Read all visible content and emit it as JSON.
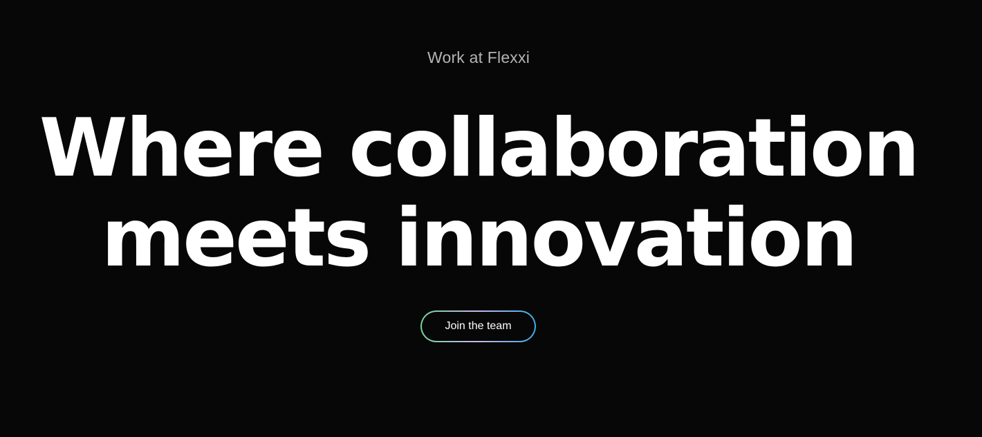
{
  "hero": {
    "eyebrow": "Work at Flexxi",
    "headline_line1": "Where collaboration",
    "headline_line2": "meets innovation",
    "cta_label": "Join the team"
  },
  "colors": {
    "background": "#070707",
    "headline": "#ffffff",
    "eyebrow": "#b4b4b4",
    "cta_gradient_start": "#6fd39a",
    "cta_gradient_mid": "#c8b6ea",
    "cta_gradient_end": "#3aaae6"
  }
}
